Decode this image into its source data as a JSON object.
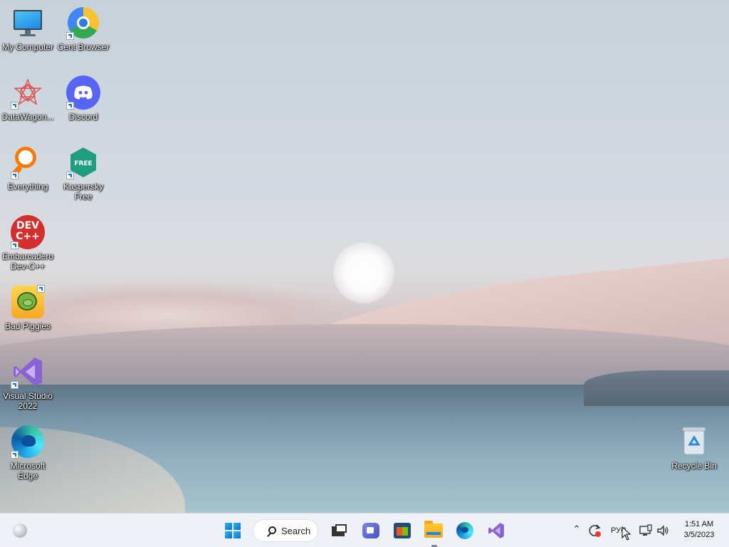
{
  "desktop": {
    "icons": [
      {
        "label": "My Computer",
        "icon": "monitor-icon",
        "shortcut": false
      },
      {
        "label": "Cent Browser",
        "icon": "cent-browser-icon",
        "shortcut": true
      },
      {
        "label": "DataWagon...",
        "icon": "datawagon-icon",
        "shortcut": true
      },
      {
        "label": "Discord",
        "icon": "discord-icon",
        "shortcut": true
      },
      {
        "label": "Everything",
        "icon": "everything-icon",
        "shortcut": true
      },
      {
        "label": "Kaspersky Free",
        "icon": "kaspersky-icon",
        "shortcut": true,
        "badge": "FREE"
      },
      {
        "label": "Embarcadero Dev-C++",
        "icon": "devcpp-icon",
        "shortcut": true,
        "badge_lines": [
          "DEV",
          "C++"
        ]
      },
      {
        "label": "Bad Piggies",
        "icon": "bad-piggies-icon",
        "shortcut": true
      },
      {
        "label": "Visual Studio 2022",
        "icon": "visual-studio-icon",
        "shortcut": true
      },
      {
        "label": "Microsoft Edge",
        "icon": "edge-icon",
        "shortcut": true
      },
      {
        "label": "Recycle Bin",
        "icon": "recycle-bin-icon",
        "shortcut": false
      }
    ]
  },
  "taskbar": {
    "search_label": "Search",
    "pinned": [
      "widgets-icon",
      "start-icon",
      "task-view-icon",
      "teams-chat-icon",
      "microsoft-store-icon",
      "file-explorer-icon",
      "edge-icon",
      "visual-studio-icon"
    ],
    "running_app": "file-explorer-icon",
    "tray": {
      "language": "РУС",
      "time": "1:51 AM",
      "date": "3/5/2023"
    }
  },
  "colors": {
    "taskbar_bg": "#eef1f5",
    "accent": "#0b6fd3"
  }
}
